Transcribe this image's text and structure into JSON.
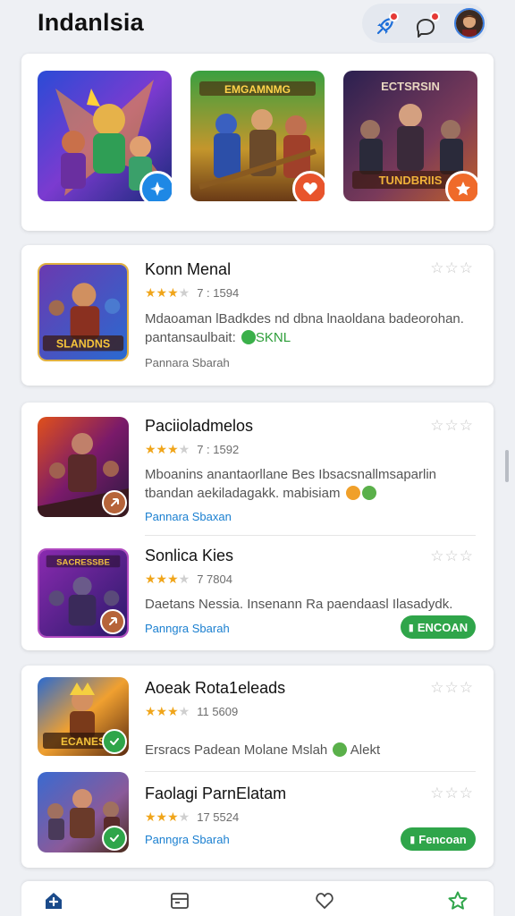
{
  "header": {
    "title": "Indanlsia",
    "icons": [
      "rocket-icon",
      "chat-icon",
      "avatar"
    ]
  },
  "featured": [
    {
      "name": "featured-game-1",
      "badge_icon": "compass-icon",
      "badge_color": "#1e88e5"
    },
    {
      "name": "featured-game-2",
      "badge_icon": "heart-icon",
      "badge_color": "#e8542c"
    },
    {
      "name": "featured-game-3",
      "badge_icon": "star-icon",
      "badge_color": "#ef6a2a"
    }
  ],
  "featured_banner_texts": [
    "EMGAMNMG",
    "ECTSRSIN",
    "TUNDBRIIS"
  ],
  "games": [
    {
      "title": "Konn Menal",
      "rating_value": 3.5,
      "rating_text": "7 : 1594",
      "desc_line1": "Mdaoaman lBadkdes nd dbna lnaoldana badeorohan.",
      "desc_line2": "pantansaulbait:",
      "desc_line2_green": "SKNL",
      "meta": "Pannara Sbarah",
      "thumb_text": "SLANDNS"
    },
    {
      "title": "Paciioladmelos",
      "rating_value": 3,
      "rating_text": "7 : 1592",
      "desc_line1": "Mboanins anantaorllane Bes Ibsacsnallmsaparlin",
      "desc_line2": "tbandan aekiladagakk. mabisiam",
      "meta": "Pannara Sbaxan",
      "thumb_text": ""
    },
    {
      "title": "Sonlica Kies",
      "rating_value": 3.5,
      "rating_text": "7 7804",
      "desc_line1": "Daetans Nessia. Insenann Ra paendaasl Ilasadydk.",
      "meta": "Panngra Sbarah",
      "button": "ENCOAN",
      "thumb_text": "SACRESSBE"
    },
    {
      "title": "Aoeak Rota1eleads",
      "rating_value": 3.5,
      "rating_text": "11 5609",
      "desc_line1": "Ersracs Padean Molane Mslah",
      "desc_line1_tail": "Alekt",
      "thumb_text": "ECANES"
    },
    {
      "title": "Faolagi ParnElatam",
      "rating_value": 3.5,
      "rating_text": "17 5524",
      "meta": "Panngra Sbarah",
      "button": "Fencoan"
    }
  ],
  "nav": [
    "home-icon",
    "inbox-icon",
    "heart-icon",
    "star-icon"
  ],
  "colors": {
    "accent_green": "#2fa54a",
    "link_blue": "#1a7fd0",
    "star": "#f0a51a"
  }
}
